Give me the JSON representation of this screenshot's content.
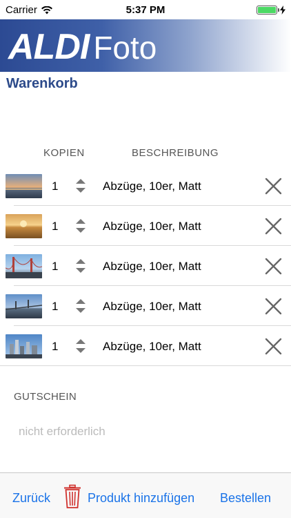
{
  "status_bar": {
    "carrier": "Carrier",
    "time": "5:37 PM",
    "icons": [
      "wifi-icon",
      "battery-icon",
      "charging-bolt-icon"
    ]
  },
  "banner": {
    "brand": "ALDI",
    "product": "Foto"
  },
  "page_title": "Warenkorb",
  "columns": {
    "copies": "KOPIEN",
    "description": "BESCHREIBUNG"
  },
  "cart_items": [
    {
      "quantity": "1",
      "description": "Abzüge, 10er, Matt",
      "thumbnail": "sunset-sea-photo"
    },
    {
      "quantity": "1",
      "description": "Abzüge, 10er, Matt",
      "thumbnail": "golden-sea-photo"
    },
    {
      "quantity": "1",
      "description": "Abzüge, 10er, Matt",
      "thumbnail": "golden-gate-bridge-photo"
    },
    {
      "quantity": "1",
      "description": "Abzüge, 10er, Matt",
      "thumbnail": "bay-bridge-photo"
    },
    {
      "quantity": "1",
      "description": "Abzüge, 10er, Matt",
      "thumbnail": "city-skyline-photo"
    }
  ],
  "voucher": {
    "label": "GUTSCHEIN",
    "placeholder": "nicht erforderlich"
  },
  "toolbar": {
    "back_label": "Zurück",
    "add_product_label": "Produkt hinzufügen",
    "order_label": "Bestellen"
  },
  "colors": {
    "accent": "#1a73e8",
    "title": "#2c4a8a",
    "trash": "#d0312d",
    "battery": "#4cd964"
  }
}
